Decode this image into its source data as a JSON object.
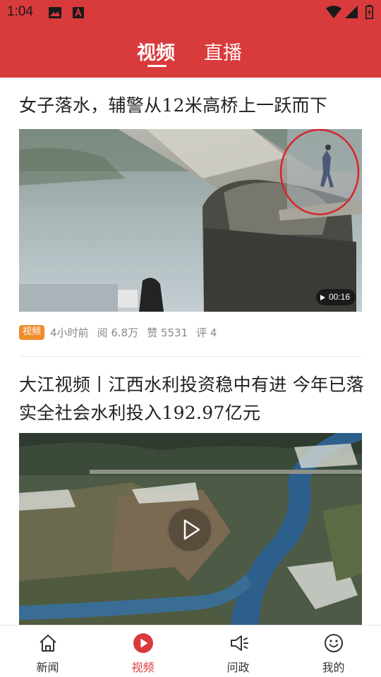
{
  "status_bar": {
    "time": "1:04"
  },
  "header": {
    "tabs": [
      {
        "label": "视频",
        "active": true
      },
      {
        "label": "直播",
        "active": false
      }
    ]
  },
  "articles": [
    {
      "title": "女子落水，辅警从12米高桥上一跃而下",
      "duration": "00:16",
      "badge": "视频",
      "time_ago": "4小时前",
      "views": "阅 6.8万",
      "likes": "赞 5531",
      "comments": "评 4"
    },
    {
      "title": "大江视频丨江西水利投资稳中有进 今年已落实全社会水利投入192.97亿元"
    }
  ],
  "bottom_nav": [
    {
      "label": "新闻",
      "icon": "home-icon",
      "active": false
    },
    {
      "label": "视频",
      "icon": "play-circle-icon",
      "active": true
    },
    {
      "label": "问政",
      "icon": "megaphone-icon",
      "active": false
    },
    {
      "label": "我的",
      "icon": "smiley-icon",
      "active": false
    }
  ],
  "colors": {
    "brand_red": "#d93a3c",
    "badge_orange": "#f08c2a"
  }
}
